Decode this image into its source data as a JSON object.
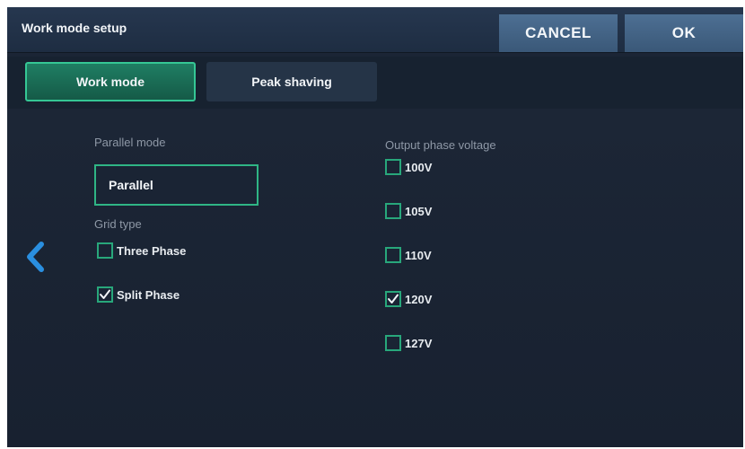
{
  "header": {
    "title": "Work mode setup",
    "cancel_label": "CANCEL",
    "ok_label": "OK"
  },
  "tabs": [
    {
      "label": "Work mode",
      "active": true
    },
    {
      "label": "Peak shaving",
      "active": false
    }
  ],
  "parallel_mode": {
    "label": "Parallel mode",
    "value": "Parallel"
  },
  "grid_type": {
    "label": "Grid type",
    "options": [
      {
        "label": "Three Phase",
        "checked": false
      },
      {
        "label": "Split Phase",
        "checked": true
      }
    ]
  },
  "output_phase_voltage": {
    "label": "Output phase voltage",
    "options": [
      {
        "label": "100V",
        "checked": false
      },
      {
        "label": "105V",
        "checked": false
      },
      {
        "label": "110V",
        "checked": false
      },
      {
        "label": "120V",
        "checked": true
      },
      {
        "label": "127V",
        "checked": false
      }
    ]
  },
  "colors": {
    "accent": "#35c795",
    "background": "#1b2535",
    "button": "#3a5878"
  },
  "icons": {
    "back": "chevron-left-icon",
    "check": "checkmark-icon"
  }
}
